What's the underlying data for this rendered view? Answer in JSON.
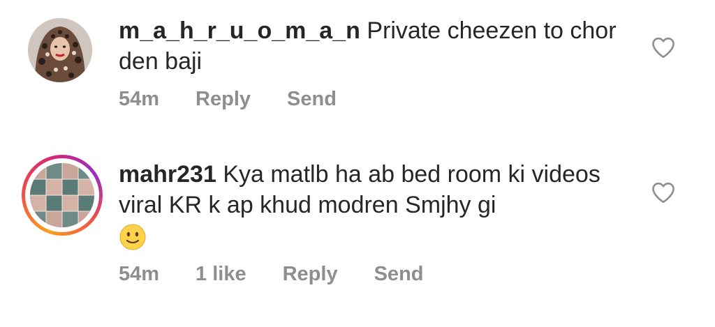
{
  "comments": [
    {
      "username": "m_a_h_r_u_o_m_a_n",
      "text": "Private cheezen to chor den baji",
      "time": "54m",
      "likes": "",
      "reply_label": "Reply",
      "send_label": "Send"
    },
    {
      "username": "mahr231",
      "text": "Kya matlb ha ab bed room ki videos viral KR k ap khud modren Smjhy gi",
      "emoji": "slightly-smiling-face",
      "time": "54m",
      "likes": "1 like",
      "reply_label": "Reply",
      "send_label": "Send"
    }
  ],
  "icons": {
    "like": "heart-outline-icon"
  },
  "colors": {
    "text": "#262626",
    "meta": "#8e8e8e",
    "story_ring_start": "#f9a11b",
    "story_ring_end": "#d62976"
  }
}
